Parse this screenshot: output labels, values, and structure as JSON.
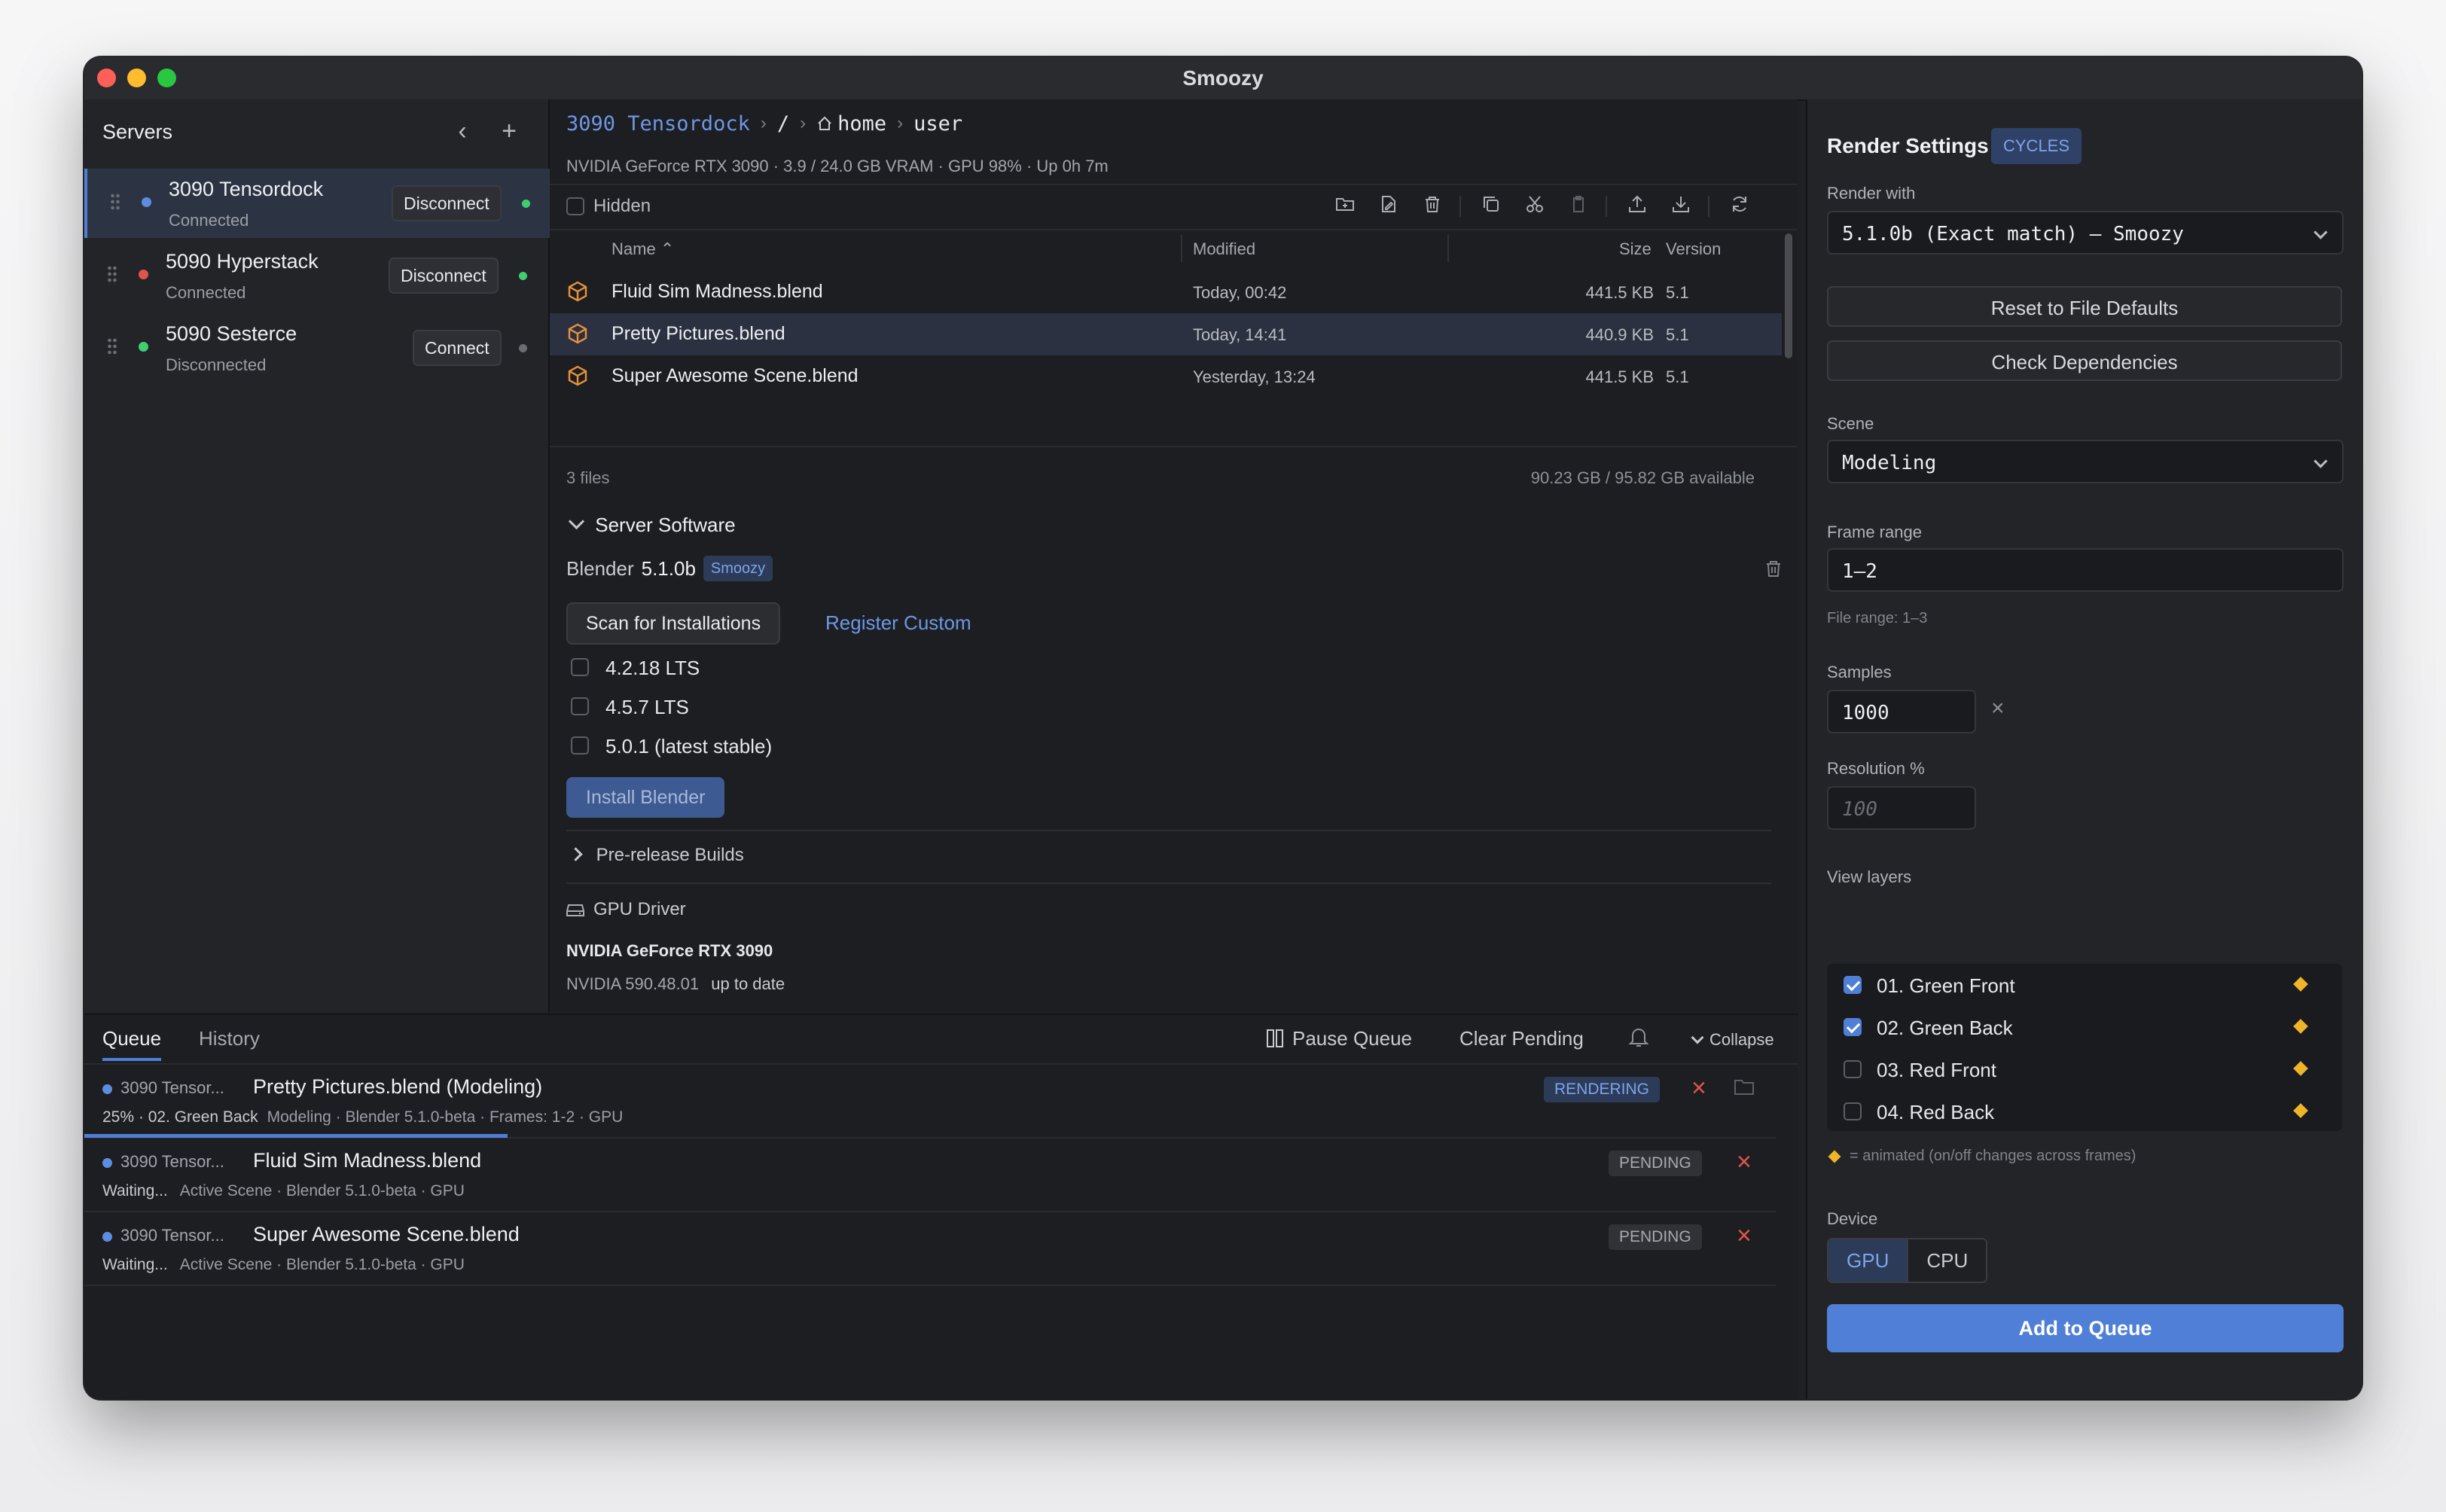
{
  "window": {
    "title": "Smoozy"
  },
  "sidebar": {
    "title": "Servers",
    "servers": [
      {
        "name": "3090 Tensordock",
        "status": "Connected",
        "action": "Disconnect",
        "dot_color": "#5c8de0",
        "indicator_color": "#3fcf6e"
      },
      {
        "name": "5090 Hyperstack",
        "status": "Connected",
        "action": "Disconnect",
        "dot_color": "#e0544c",
        "indicator_color": "#3fcf6e"
      },
      {
        "name": "5090 Sesterce",
        "status": "Disconnected",
        "action": "Connect",
        "dot_color": "#3fcf6e",
        "indicator_color": "#6a6d74"
      }
    ]
  },
  "breadcrumb": {
    "server": "3090 Tensordock",
    "root": "/",
    "home": "home",
    "user": "user"
  },
  "gpu_info": "NVIDIA GeForce RTX 3090 · 3.9 / 24.0 GB VRAM · GPU 98% · Up 0h 7m",
  "toolbar": {
    "hidden_label": "Hidden"
  },
  "table": {
    "headers": {
      "name": "Name",
      "modified": "Modified",
      "size": "Size",
      "version": "Version"
    },
    "rows": [
      {
        "name": "Fluid Sim Madness.blend",
        "modified": "Today, 00:42",
        "size": "441.5 KB",
        "version": "5.1"
      },
      {
        "name": "Pretty Pictures.blend",
        "modified": "Today, 14:41",
        "size": "440.9 KB",
        "version": "5.1"
      },
      {
        "name": "Super Awesome Scene.blend",
        "modified": "Yesterday, 13:24",
        "size": "441.5 KB",
        "version": "5.1"
      }
    ],
    "file_count": "3 files",
    "storage": "90.23 GB / 95.82 GB available"
  },
  "server_software": {
    "title": "Server Software",
    "blender_label": "Blender",
    "blender_version": "5.1.0b",
    "badge": "Smoozy",
    "scan_button": "Scan for Installations",
    "register_link": "Register Custom",
    "options": [
      "4.2.18 LTS",
      "4.5.7 LTS",
      "5.0.1 (latest stable)"
    ],
    "install_button": "Install Blender",
    "prerelease": "Pre-release Builds",
    "gpu_driver_title": "GPU Driver",
    "gpu_driver_name": "NVIDIA GeForce RTX 3090",
    "driver_version": "NVIDIA 590.48.01",
    "driver_status": "up to date"
  },
  "queue": {
    "tabs": [
      "Queue",
      "History"
    ],
    "actions": {
      "pause": "Pause Queue",
      "clear": "Clear Pending",
      "collapse": "Collapse"
    },
    "items": [
      {
        "server": "3090 Tensor...",
        "file": "Pretty Pictures.blend (Modeling)",
        "progress_text": "25% · 02. Green Back",
        "meta": "Modeling · Blender 5.1.0-beta · Frames: 1-2 · GPU",
        "status": "RENDERING",
        "progress": 0.25
      },
      {
        "server": "3090 Tensor...",
        "file": "Fluid Sim Madness.blend",
        "progress_text": "Waiting...",
        "meta": "Active Scene · Blender 5.1.0-beta · GPU",
        "status": "PENDING"
      },
      {
        "server": "3090 Tensor...",
        "file": "Super Awesome Scene.blend",
        "progress_text": "Waiting...",
        "meta": "Active Scene · Blender 5.1.0-beta · GPU",
        "status": "PENDING"
      }
    ]
  },
  "render": {
    "title": "Render Settings",
    "engine": "CYCLES",
    "render_with_label": "Render with",
    "render_with_value": "5.1.0b (Exact match) — Smoozy",
    "reset_button": "Reset to File Defaults",
    "check_button": "Check Dependencies",
    "scene_label": "Scene",
    "scene_value": "Modeling",
    "frame_label": "Frame range",
    "frame_value": "1–2",
    "file_range": "File range: 1–3",
    "samples_label": "Samples",
    "samples_value": "1000",
    "resolution_label": "Resolution %",
    "resolution_placeholder": "100",
    "view_layers_label": "View layers",
    "view_layers": [
      {
        "name": "01. Green Front",
        "checked": true
      },
      {
        "name": "02. Green Back",
        "checked": true
      },
      {
        "name": "03. Red Front",
        "checked": false
      },
      {
        "name": "04. Red Back",
        "checked": false
      }
    ],
    "animated_note": "= animated (on/off changes across frames)",
    "device_label": "Device",
    "device_options": [
      "GPU",
      "CPU"
    ],
    "device_selected": "GPU",
    "add_button": "Add to Queue"
  },
  "colors": {
    "accent": "#4f7fd6",
    "warning": "#f0b429",
    "danger": "#e0544c",
    "file_icon": "#e8913a"
  }
}
